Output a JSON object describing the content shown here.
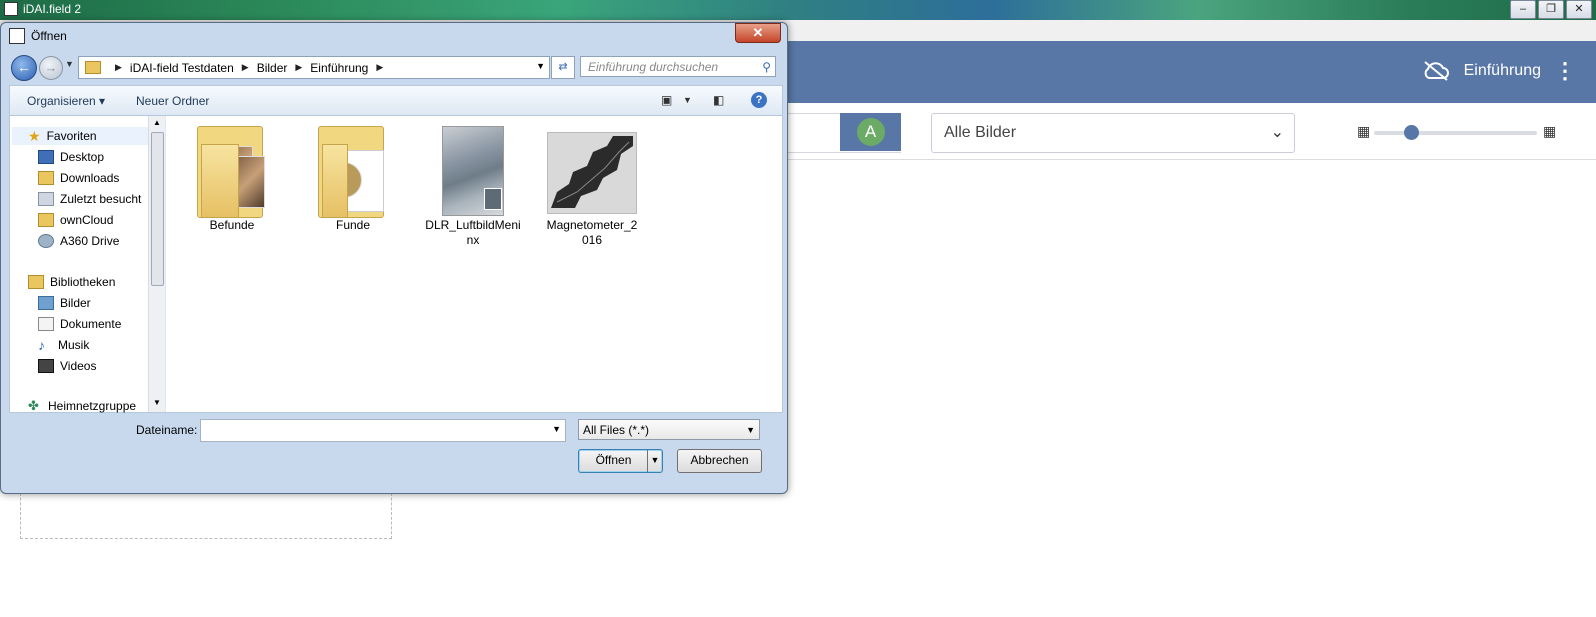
{
  "app": {
    "window_title": "iDAI.field 2",
    "project_name": "Einführung",
    "filter_avatar_letter": "A",
    "filter_select_value": "Alle Bilder"
  },
  "dialog": {
    "title": "Öffnen",
    "close_label": "X",
    "breadcrumbs": [
      "iDAI-field Testdaten",
      "Bilder",
      "Einführung"
    ],
    "search_placeholder": "Einführung durchsuchen",
    "commands": {
      "organize": "Organisieren",
      "new_folder": "Neuer Ordner"
    },
    "nav_pane": {
      "favorites_header": "Favoriten",
      "favorites": [
        "Desktop",
        "Downloads",
        "Zuletzt besucht",
        "ownCloud",
        "A360 Drive"
      ],
      "libraries_header": "Bibliotheken",
      "libraries": [
        "Bilder",
        "Dokumente",
        "Musik",
        "Videos"
      ],
      "homegroup": "Heimnetzgruppe"
    },
    "files": [
      {
        "name": "Befunde",
        "kind": "folder"
      },
      {
        "name": "Funde",
        "kind": "folder"
      },
      {
        "name": "DLR_LuftbildMeninx",
        "kind": "image"
      },
      {
        "name": "Magnetometer_2016",
        "kind": "image"
      }
    ],
    "filename_label": "Dateiname:",
    "filename_value": "",
    "filetype_value": "All Files (*.*)",
    "open_button": "Öffnen",
    "cancel_button": "Abbrechen"
  },
  "colors": {
    "app_nav": "#5877a6",
    "dialog_frame": "#c8d9ee",
    "close_red": "#c4452a"
  }
}
